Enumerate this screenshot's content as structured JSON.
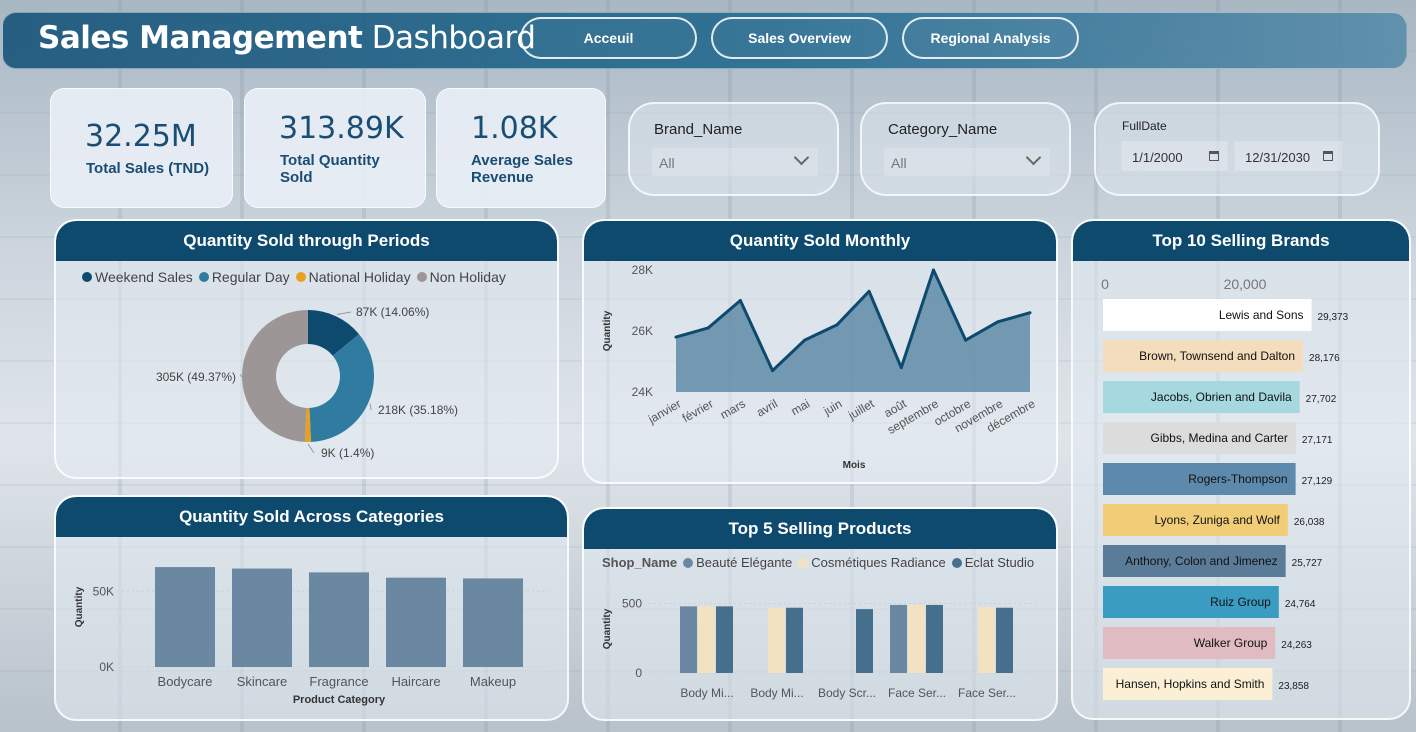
{
  "header": {
    "title_bold": "Sales Management",
    "title_light": "Dashboard",
    "nav": [
      "Acceuil",
      "Sales Overview",
      "Regional Analysis"
    ]
  },
  "kpis": [
    {
      "value": "32.25M",
      "label": "Total Sales (TND)"
    },
    {
      "value": "313.89K",
      "label": "Total Quantity Sold"
    },
    {
      "value": "1.08K",
      "label": "Average Sales Revenue"
    }
  ],
  "slicers": {
    "brand": {
      "title": "Brand_Name",
      "value": "All"
    },
    "category": {
      "title": "Category_Name",
      "value": "All"
    },
    "date": {
      "title": "FullDate",
      "start": "1/1/2000",
      "end": "12/31/2030"
    }
  },
  "colors": {
    "header": "#0e4a6e",
    "weekend": "#0e4a6e",
    "regular": "#2f7ca0",
    "national": "#e8a020",
    "nonholiday": "#9c9696",
    "area": "#0e4a6e",
    "category_bar": "#6b88a3"
  },
  "chart_data": [
    {
      "type": "pie",
      "title": "Quantity Sold through Periods",
      "legend": [
        "Weekend Sales",
        "Regular Day",
        "National Holiday",
        "Non Holiday"
      ],
      "slices": [
        {
          "name": "Weekend Sales",
          "value": 87,
          "label": "87K (14.06%)"
        },
        {
          "name": "Regular Day",
          "value": 218,
          "label": "218K (35.18%)"
        },
        {
          "name": "National Holiday",
          "value": 9,
          "label": "9K (1.4%)"
        },
        {
          "name": "Non Holiday",
          "value": 305,
          "label": "305K (49.37%)"
        }
      ]
    },
    {
      "type": "area",
      "title": "Quantity Sold Monthly",
      "xlabel": "Mois",
      "ylabel": "Quantity",
      "ylim": [
        24000,
        28000
      ],
      "yticks": [
        "28K",
        "26K",
        "24K"
      ],
      "categories": [
        "janvier",
        "février",
        "mars",
        "avril",
        "mai",
        "juin",
        "juillet",
        "août",
        "septembre",
        "octobre",
        "novembre",
        "décembre"
      ],
      "values": [
        25800,
        26100,
        27000,
        24700,
        25700,
        26200,
        27300,
        24800,
        28000,
        25700,
        26300,
        26600
      ]
    },
    {
      "type": "bar",
      "title": "Top 10 Selling Brands",
      "axis_ticks": [
        "0",
        "20,000"
      ],
      "categories": [
        "Lewis and Sons",
        "Brown, Townsend and Dalton",
        "Jacobs, Obrien and Davila",
        "Gibbs, Medina and Carter",
        "Rogers-Thompson",
        "Lyons, Zuniga and Wolf",
        "Anthony, Colon and Jimenez",
        "Ruiz Group",
        "Walker Group",
        "Hansen, Hopkins and Smith"
      ],
      "values": [
        29373,
        28176,
        27702,
        27171,
        27129,
        26038,
        25727,
        24764,
        24263,
        23858
      ],
      "value_labels": [
        "29,373",
        "28,176",
        "27,702",
        "27,171",
        "27,129",
        "26,038",
        "25,727",
        "24,764",
        "24,263",
        "23,858"
      ],
      "bar_colors": [
        "#ffffff",
        "#f3ddbc",
        "#a6d8e0",
        "#dcdcdc",
        "#5d8aac",
        "#f2cd78",
        "#5b7c99",
        "#3a9cc1",
        "#e0bcc2",
        "#fbf0d6"
      ]
    },
    {
      "type": "bar",
      "title": "Quantity Sold Across Categories",
      "xlabel": "Product Category",
      "ylabel": "Quantity",
      "yticks": [
        "50K",
        "0K"
      ],
      "ylim": [
        0,
        70000
      ],
      "categories": [
        "Bodycare",
        "Skincare",
        "Fragrance",
        "Haircare",
        "Makeup"
      ],
      "values": [
        66000,
        65000,
        62500,
        59000,
        58500
      ]
    },
    {
      "type": "bar",
      "title": "Top 5 Selling Products",
      "legend_title": "Shop_Name",
      "ylabel": "Quantity",
      "yticks": [
        "500",
        "0"
      ],
      "ylim": [
        0,
        540
      ],
      "categories": [
        "Body Mi...",
        "Body Mi...",
        "Body Scr...",
        "Face Ser...",
        "Face Ser..."
      ],
      "series": [
        {
          "name": "Beauté Elégante",
          "color": "#6b88a3",
          "values": [
            480,
            0,
            0,
            490,
            0
          ]
        },
        {
          "name": "Cosmétiques Radiance",
          "color": "#f3e2c2",
          "values": [
            480,
            470,
            0,
            490,
            475
          ]
        },
        {
          "name": "Eclat Studio",
          "color": "#466f8e",
          "values": [
            480,
            470,
            460,
            490,
            470
          ]
        }
      ]
    }
  ]
}
